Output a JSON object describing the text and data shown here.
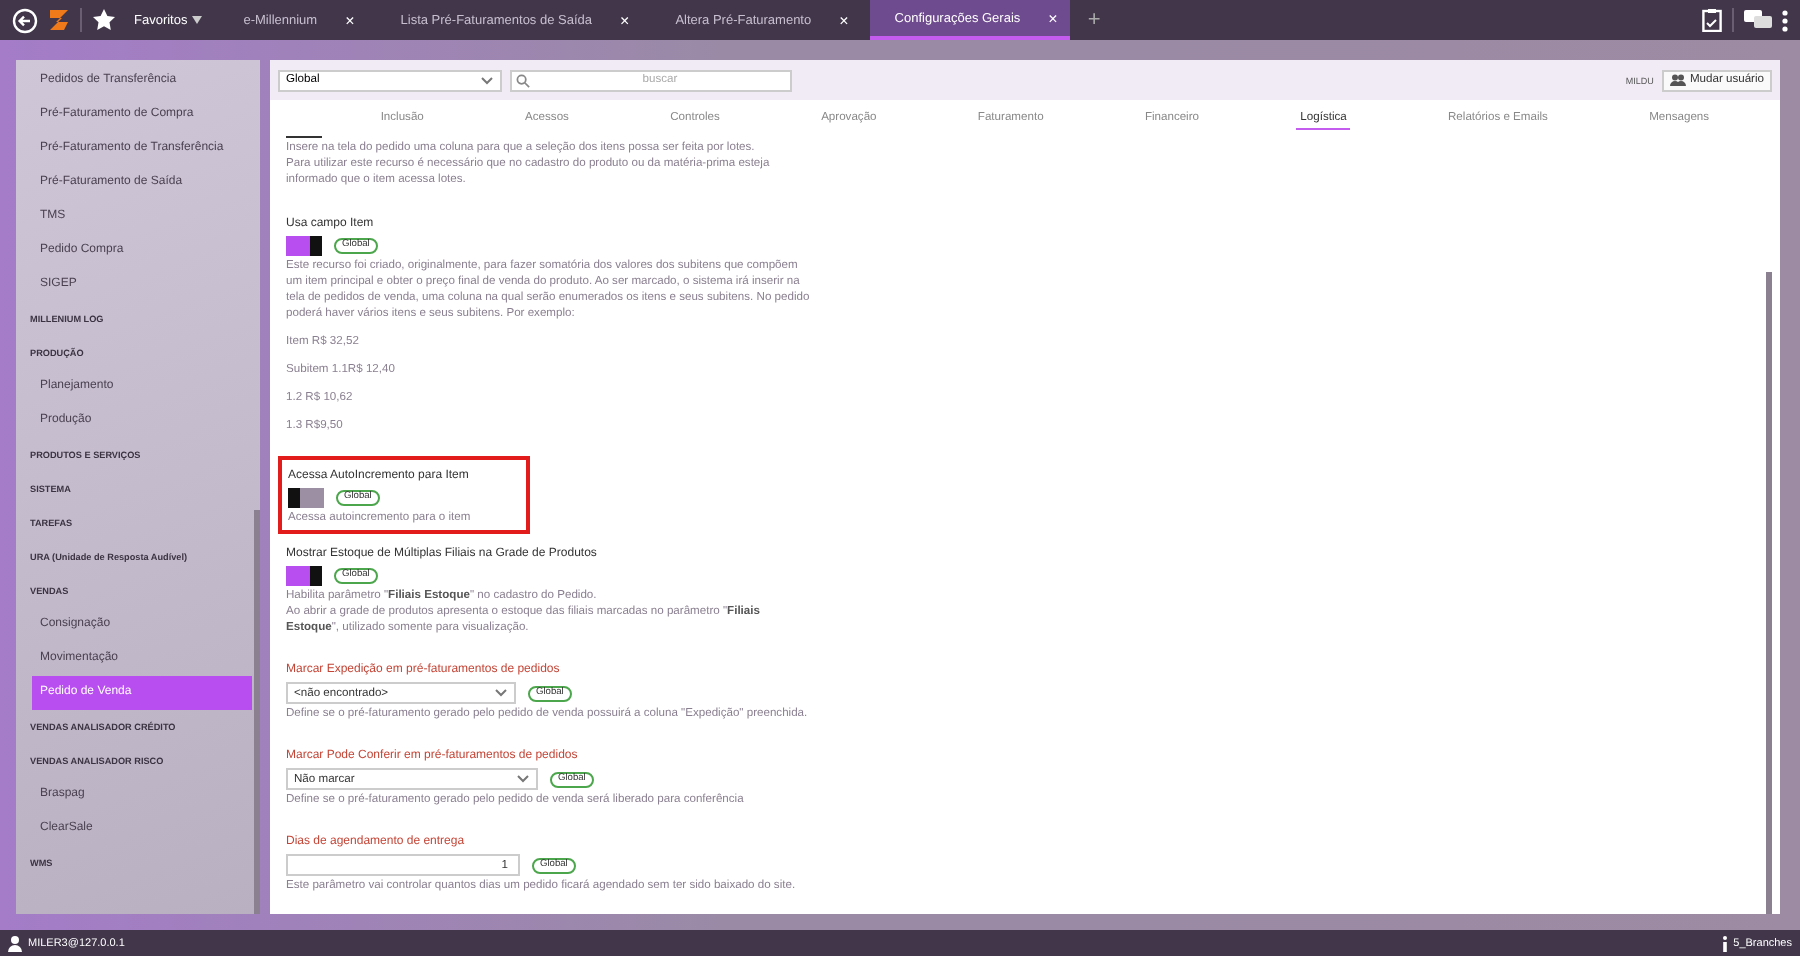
{
  "topbar": {
    "favorites": "Favoritos",
    "tabs": [
      {
        "label": "e-Millennium",
        "selected": false,
        "close": "×"
      },
      {
        "label": "Lista Pré-Faturamentos de Saída",
        "selected": false,
        "close": "×"
      },
      {
        "label": "Altera Pré-Faturamento",
        "selected": false,
        "close": "×"
      },
      {
        "label": "Configurações Gerais",
        "selected": true,
        "close": "×"
      }
    ],
    "add": "+"
  },
  "sidebar": {
    "items": [
      {
        "kind": "item",
        "label": "Pedidos de Transferência",
        "selected": false
      },
      {
        "kind": "item",
        "label": "Pré-Faturamento de Compra",
        "selected": false
      },
      {
        "kind": "item",
        "label": "Pré-Faturamento de Transferência",
        "selected": false
      },
      {
        "kind": "item",
        "label": "Pré-Faturamento de Saída",
        "selected": false
      },
      {
        "kind": "item",
        "label": "TMS",
        "selected": false
      },
      {
        "kind": "item",
        "label": "Pedido Compra",
        "selected": false
      },
      {
        "kind": "item",
        "label": "SIGEP",
        "selected": false
      },
      {
        "kind": "group",
        "label": "MILLENIUM LOG",
        "selected": false
      },
      {
        "kind": "group",
        "label": "PRODUÇÃO",
        "selected": false
      },
      {
        "kind": "item",
        "label": "Planejamento",
        "selected": false
      },
      {
        "kind": "item",
        "label": "Produção",
        "selected": false
      },
      {
        "kind": "group",
        "label": "PRODUTOS E SERVIÇOS",
        "selected": false
      },
      {
        "kind": "group",
        "label": "SISTEMA",
        "selected": false
      },
      {
        "kind": "group",
        "label": "TAREFAS",
        "selected": false
      },
      {
        "kind": "group",
        "label": "URA (Unidade de Resposta Audível)",
        "selected": false
      },
      {
        "kind": "group",
        "label": "VENDAS",
        "selected": false
      },
      {
        "kind": "item",
        "label": "Consignação",
        "selected": false
      },
      {
        "kind": "item",
        "label": "Movimentação",
        "selected": false
      },
      {
        "kind": "item",
        "label": "Pedido de Venda",
        "selected": true
      },
      {
        "kind": "group",
        "label": "VENDAS ANALISADOR CRÉDITO",
        "selected": false
      },
      {
        "kind": "group",
        "label": "VENDAS ANALISADOR RISCO",
        "selected": false
      },
      {
        "kind": "item",
        "label": "Braspag",
        "selected": false
      },
      {
        "kind": "item",
        "label": "ClearSale",
        "selected": false
      },
      {
        "kind": "group",
        "label": "WMS",
        "selected": false
      }
    ]
  },
  "header": {
    "scope": "Global",
    "search_placeholder": "buscar",
    "user": "MILDU",
    "change_user": "Mudar usuário"
  },
  "tabs": [
    {
      "label": "Inclusão",
      "selected": false
    },
    {
      "label": "Acessos",
      "selected": false
    },
    {
      "label": "Controles",
      "selected": false
    },
    {
      "label": "Aprovação",
      "selected": false
    },
    {
      "label": "Faturamento",
      "selected": false
    },
    {
      "label": "Financeiro",
      "selected": false
    },
    {
      "label": "Logística",
      "selected": true
    },
    {
      "label": "Relatórios e Emails",
      "selected": false
    },
    {
      "label": "Mensagens",
      "selected": false
    }
  ],
  "settings": [
    {
      "kind": "text",
      "description": [
        "Insere na tela do pedido uma coluna para que a seleção dos itens possa ser feita por lotes.",
        "Para utilizar este recurso é necessário que no cadastro do produto ou da matéria-prima esteja informado que o item acessa lotes."
      ]
    },
    {
      "kind": "toggle",
      "title": "Usa campo Item",
      "on": true,
      "badge": "Global",
      "highlighted": false,
      "description": [
        "Este recurso foi criado, originalmente, para fazer somatória dos valores dos subitens que compõem um item principal e obter o preço final de venda do produto. Ao ser marcado, o sistema irá inserir na tela de pedidos de venda, uma coluna na qual serão enumerados os itens e seus subitens. No pedido poderá haver vários itens e seus subitens. Por exemplo:"
      ],
      "examples": [
        "Item R$ 32,52",
        "Subitem 1.1R$ 12,40",
        "1.2 R$ 10,62",
        "1.3 R$9,50"
      ]
    },
    {
      "kind": "toggle",
      "title": "Acessa AutoIncremento para Item",
      "on": false,
      "badge": "Global",
      "highlighted": true,
      "description": [
        "Acessa autoincremento para o item"
      ]
    },
    {
      "kind": "toggle",
      "title": "Mostrar Estoque de Múltiplas Filiais na Grade de Produtos",
      "on": true,
      "badge": "Global",
      "highlighted": false,
      "description": [
        "Habilita parâmetro \"**Filiais Estoque**\" no cadastro do Pedido.",
        "Ao abrir a grade de produtos apresenta o estoque das filiais marcadas no parâmetro \"**Filiais Estoque**\", utilizado somente para visualização."
      ]
    },
    {
      "kind": "select",
      "title": "Marcar Expedição em pré-faturamentos de pedidos",
      "value": "<não encontrado>",
      "badge": "Global",
      "description": [
        "Define se o pré-faturamento gerado pelo pedido de venda possuirá a coluna \"Expedição\" preenchida."
      ]
    },
    {
      "kind": "select",
      "title": "Marcar Pode Conferir em pré-faturamentos de pedidos",
      "value": "Não marcar",
      "badge": "Global",
      "description": [
        "Define se o pré-faturamento gerado pelo pedido de venda será liberado para conferência"
      ]
    },
    {
      "kind": "number",
      "title": "Dias de agendamento de entrega",
      "value": "1",
      "badge": "Global",
      "description": [
        "Este parâmetro vai controlar quantos dias um pedido ficará agendado sem ter sido baixado do site."
      ]
    }
  ],
  "status_bar": {
    "user": "MILER3@127.0.0.1",
    "branches": "5_Branches"
  }
}
